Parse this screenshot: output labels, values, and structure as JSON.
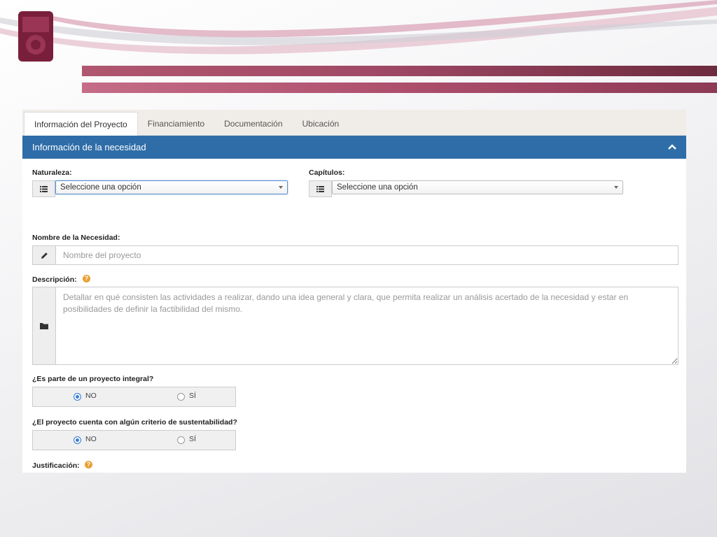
{
  "tabs": [
    {
      "label": "Información del Proyecto",
      "active": true
    },
    {
      "label": "Financiamiento",
      "active": false
    },
    {
      "label": "Documentación",
      "active": false
    },
    {
      "label": "Ubicación",
      "active": false
    }
  ],
  "panel": {
    "title": "Información de la necesidad"
  },
  "naturaleza": {
    "label": "Naturaleza:",
    "value": "Seleccione una opción"
  },
  "capitulos": {
    "label": "Capítulos:",
    "value": "Seleccione una opción"
  },
  "nombre": {
    "label": "Nombre de la Necesidad:",
    "placeholder": "Nombre del proyecto"
  },
  "descripcion": {
    "label": "Descripción:",
    "placeholder": "Detallar en qué consisten las actividades a realizar, dando una idea general y clara, que permita realizar un análisis acertado de la necesidad y estar en posibilidades de definir la factibilidad del mismo."
  },
  "integral": {
    "label": "¿Es parte de un proyecto integral?",
    "options": [
      "NO",
      "SÍ"
    ],
    "selected": "NO"
  },
  "sustentabilidad": {
    "label": "¿El proyecto cuenta con algún criterio de sustentabilidad?",
    "options": [
      "NO",
      "SÍ"
    ],
    "selected": "NO"
  },
  "justificacion": {
    "label": "Justificación:"
  },
  "colors": {
    "header_blue": "#2e6da8",
    "band_maroon": "#a14a67",
    "help_orange": "#e8a030",
    "radio_blue": "#3b7fd4"
  },
  "icons": {
    "logo": "ipn-logo",
    "list": "list-icon",
    "pencil": "pencil-icon",
    "folder": "folder-icon",
    "help": "question-icon",
    "collapse": "chevron-up-icon"
  }
}
